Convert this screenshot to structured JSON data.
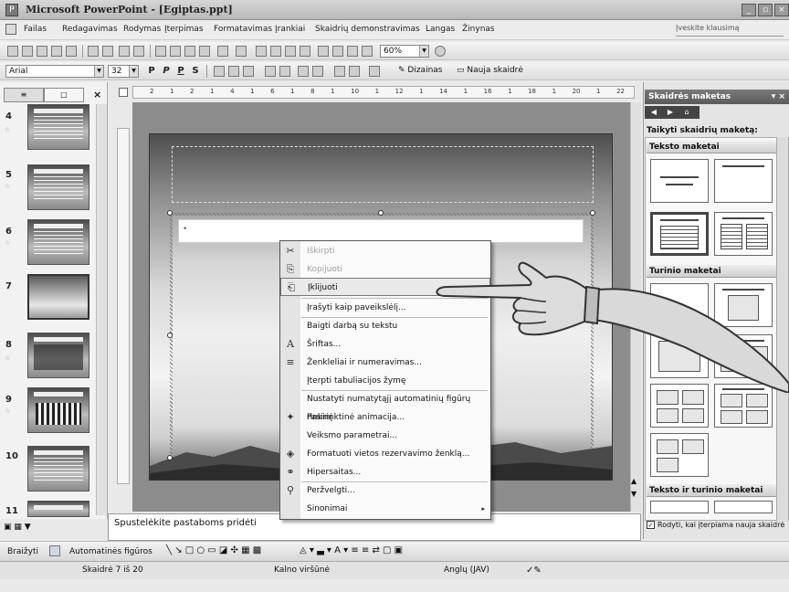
{
  "window": {
    "title": "Microsoft PowerPoint - [Egiptas.ppt]",
    "controls": [
      "_",
      "▫",
      "×"
    ]
  },
  "menu": {
    "items": [
      "Failas",
      "Redagavimas",
      "Rodymas",
      "Įterpimas",
      "Formatavimas",
      "Įrankiai",
      "Skaidrių demonstravimas",
      "Langas",
      "Žinynas"
    ],
    "help_placeholder": "Įveskite klausimą"
  },
  "standard_toolbar": {
    "zoom": "60%"
  },
  "format_toolbar": {
    "font": "Arial",
    "size": "32",
    "bold": "P",
    "italic": "P",
    "underline": "P",
    "shadow": "S",
    "design_label": "Dizainas",
    "new_slide_label": "Nauja skaidrė"
  },
  "slides_pane": {
    "tabs": [
      "≡",
      "□"
    ],
    "close": "×",
    "slides": [
      {
        "num": "4",
        "kind": "text"
      },
      {
        "num": "5",
        "kind": "text"
      },
      {
        "num": "6",
        "kind": "text"
      },
      {
        "num": "7",
        "kind": "selected"
      },
      {
        "num": "8",
        "kind": "image"
      },
      {
        "num": "9",
        "kind": "chart"
      },
      {
        "num": "10",
        "kind": "text"
      },
      {
        "num": "11",
        "kind": "text"
      }
    ]
  },
  "ruler": {
    "ticks": [
      "2",
      "1",
      "2",
      "1",
      "4",
      "1",
      "6",
      "1",
      "8",
      "1",
      "10",
      "1",
      "12",
      "1",
      "14",
      "1",
      "16",
      "1",
      "18",
      "1",
      "20",
      "1",
      "22"
    ]
  },
  "context_menu": {
    "items": [
      {
        "label": "Iškirpti",
        "icon": "✂",
        "disabled": true
      },
      {
        "label": "Kopijuoti",
        "icon": "⎘",
        "disabled": true
      },
      {
        "label": "Įklijuoti",
        "icon": "📋",
        "disabled": false,
        "highlight": true
      },
      {
        "label": "Įrašyti kaip paveikslėlį...",
        "icon": "",
        "disabled": false
      },
      {
        "label": "Baigti darbą su tekstu",
        "icon": "",
        "disabled": false
      },
      {
        "label": "Šriftas...",
        "icon": "A",
        "disabled": false
      },
      {
        "label": "Ženkleliai ir numeravimas...",
        "icon": "≡",
        "disabled": false
      },
      {
        "label": "Įterpti tabuliacijos žymę",
        "icon": "",
        "disabled": false
      },
      {
        "label": "Nustatyti numatytąjį automatinių figūrų rinkinį",
        "icon": "",
        "disabled": false
      },
      {
        "label": "Pasirinktinė animacija...",
        "icon": "✦",
        "disabled": false
      },
      {
        "label": "Veiksmo parametrai...",
        "icon": "",
        "disabled": false
      },
      {
        "label": "Formatuoti vietos rezervavimo ženklą...",
        "icon": "◈",
        "disabled": false
      },
      {
        "label": "Hipersaitas...",
        "icon": "⚭",
        "disabled": false
      },
      {
        "label": "Peržvelgti...",
        "icon": "⚲",
        "disabled": false
      },
      {
        "label": "Sinonimai",
        "icon": "",
        "disabled": false,
        "submenu": "▸"
      }
    ]
  },
  "notes": {
    "placeholder": "Spustelėkite pastaboms pridėti"
  },
  "task_pane": {
    "title": "Skaidrės maketas",
    "apply_label": "Taikyti skaidrių maketą:",
    "sections": {
      "text": "Teksto maketai",
      "content": "Turinio maketai",
      "text_content": "Teksto ir turinio maketai"
    },
    "checkbox_label": "Rodyti, kai įterpiama nauja skaidrė",
    "checkbox_checked": true
  },
  "drawing_toolbar": {
    "draw_label": "Braižyti",
    "autoshapes_label": "Automatinės figūros"
  },
  "status_bar": {
    "slide": "Skaidrė 7 iš 20",
    "design": "Kalno viršūnė",
    "language": "Anglų (JAV)"
  }
}
